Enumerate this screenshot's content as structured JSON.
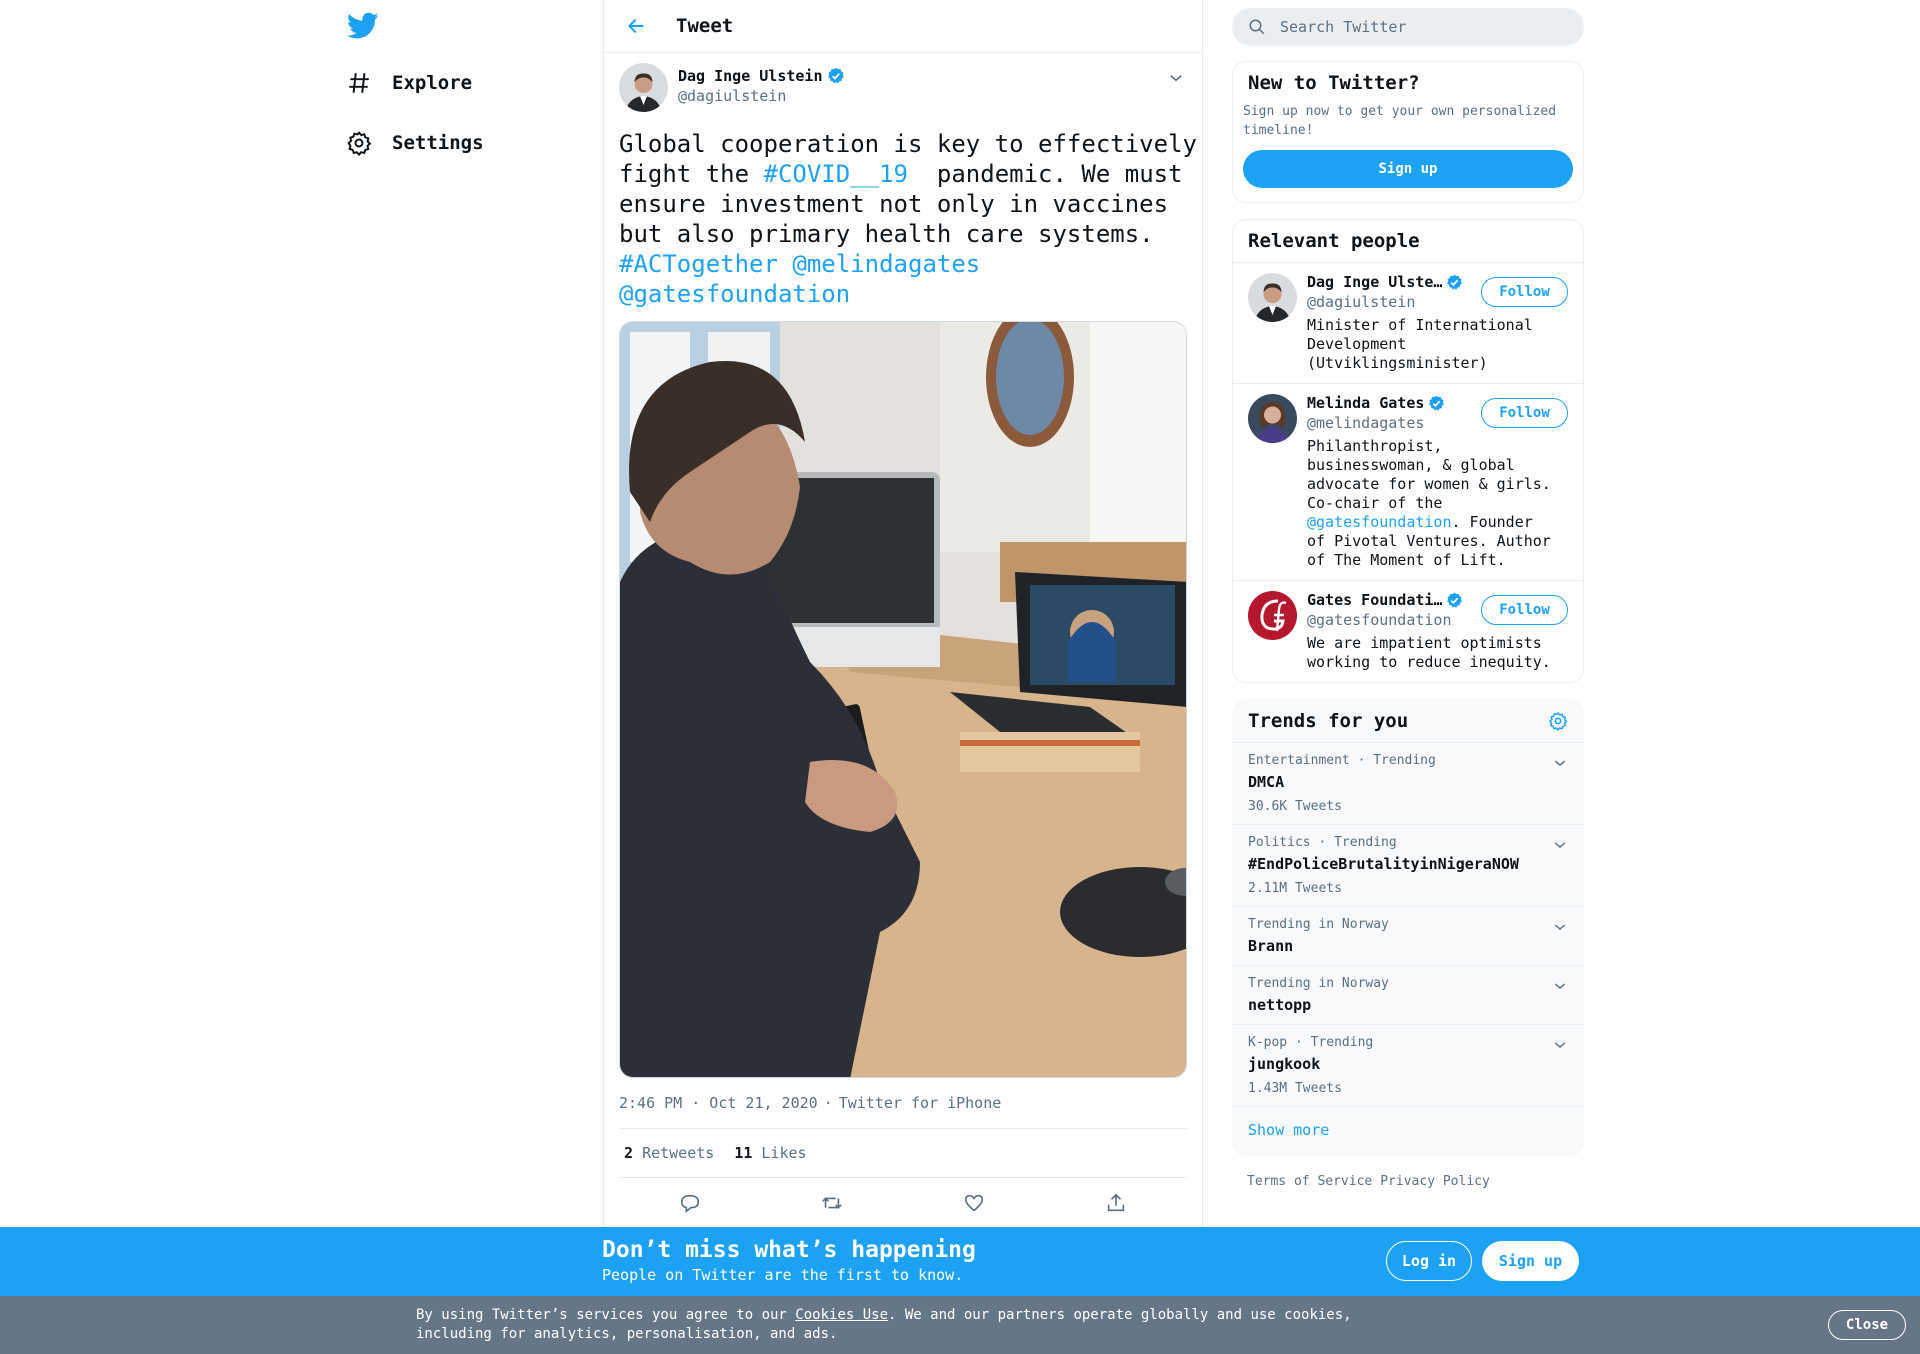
{
  "colors": {
    "accent": "#1da1f2",
    "muted": "#5b7083",
    "cookie_bar": "#657786"
  },
  "nav": {
    "logo_icon": "twitter-bird-icon",
    "items": [
      {
        "label": "Explore",
        "icon": "hashtag-icon"
      },
      {
        "label": "Settings",
        "icon": "gear-icon"
      }
    ]
  },
  "header": {
    "title": "Tweet"
  },
  "tweet": {
    "author_name": "Dag Inge Ulstein",
    "author_handle": "@dagiulstein",
    "text_parts": {
      "p1": "Global cooperation is key to effectively\nfight the ",
      "hashtag1": "#COVID__19",
      "p2": "  pandemic. We must\nensure investment not only in vaccines\nbut also primary health care systems.\n",
      "hashtag2": "#ACTogether",
      "p3": " ",
      "mention1": "@melindagates",
      "p4": "\n",
      "mention2": "@gatesfoundation"
    },
    "time": "2:46 PM · Oct 21, 2020",
    "sep": "·",
    "source": "Twitter for iPhone",
    "retweets_count": "2",
    "retweets_label": "Retweets",
    "likes_count": "11",
    "likes_label": "Likes"
  },
  "search": {
    "placeholder": "Search Twitter"
  },
  "signup_card": {
    "title": "New to Twitter?",
    "desc": "Sign up now to get your own personalized timeline!",
    "button": "Sign up"
  },
  "relevant": {
    "title": "Relevant people",
    "follow_label": "Follow",
    "people": [
      {
        "name": "Dag Inge Ulste…",
        "handle": "@dagiulstein",
        "bio": "Minister of International Development (Utviklingsminister)"
      },
      {
        "name": "Melinda Gates",
        "handle": "@melindagates",
        "bio_a": "Philanthropist, businesswoman, & global advocate for women & girls. Co-chair of the ",
        "bio_link": "@gatesfoundation",
        "bio_b": ". Founder of Pivotal Ventures. Author of The Moment of Lift."
      },
      {
        "name": "Gates Foundati…",
        "handle": "@gatesfoundation",
        "bio": "We are impatient optimists working to reduce inequity."
      }
    ]
  },
  "trends": {
    "title": "Trends for you",
    "items": [
      {
        "context": "Entertainment · Trending",
        "name": "DMCA",
        "count": "30.6K Tweets"
      },
      {
        "context": "Politics · Trending",
        "name": "#EndPoliceBrutalityinNigeraNOW",
        "count": "2.11M Tweets"
      },
      {
        "context": "Trending in Norway",
        "name": "Brann",
        "count": ""
      },
      {
        "context": "Trending in Norway",
        "name": "nettopp",
        "count": ""
      },
      {
        "context": "K-pop · Trending",
        "name": "jungkook",
        "count": "1.43M Tweets"
      }
    ],
    "show_more": "Show more"
  },
  "footer": {
    "terms": "Terms of Service",
    "privacy": "Privacy Policy"
  },
  "dont_miss": {
    "title": "Don’t miss what’s happening",
    "subtitle": "People on Twitter are the first to know.",
    "login": "Log in",
    "signup": "Sign up"
  },
  "cookies": {
    "text_a": "By using Twitter’s services you agree to our ",
    "link": "Cookies Use",
    "text_b": ". We and our partners operate globally and use cookies, including for analytics, personalisation, and ads.",
    "close": "Close"
  }
}
